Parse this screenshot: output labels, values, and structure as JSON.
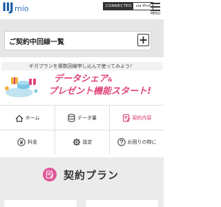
{
  "header": {
    "logo_main": "IIJ",
    "logo_sub": "mio",
    "connection_status": "CONNECTED",
    "connection_via": "via IPv4",
    "menu_label": "MENU"
  },
  "contract_lines": {
    "title": "ご契約中回線一覧"
  },
  "banner": {
    "tagline": "ギガプランを複数回線申し込んで使ってみよう！",
    "headline_1": "データシェア",
    "headline_amp": "&",
    "headline_2": "プレゼント機能スタート!"
  },
  "nav": {
    "items": [
      {
        "label": "ホーム",
        "icon": "home-icon"
      },
      {
        "label": "データ量",
        "icon": "database-icon"
      },
      {
        "label": "契約内容",
        "icon": "contract-icon"
      },
      {
        "label": "料金",
        "icon": "yen-icon"
      },
      {
        "label": "設定",
        "icon": "gear-icon"
      },
      {
        "label": "お困りの時に",
        "icon": "help-icon"
      }
    ],
    "selected_index": 2
  },
  "plan_section": {
    "title": "契約プラン"
  },
  "colors": {
    "brand_blue": "#1a5aa6",
    "accent_pink": "#e2457d",
    "highlight_red": "#d6141d",
    "band_gray": "#e6e6e6"
  }
}
